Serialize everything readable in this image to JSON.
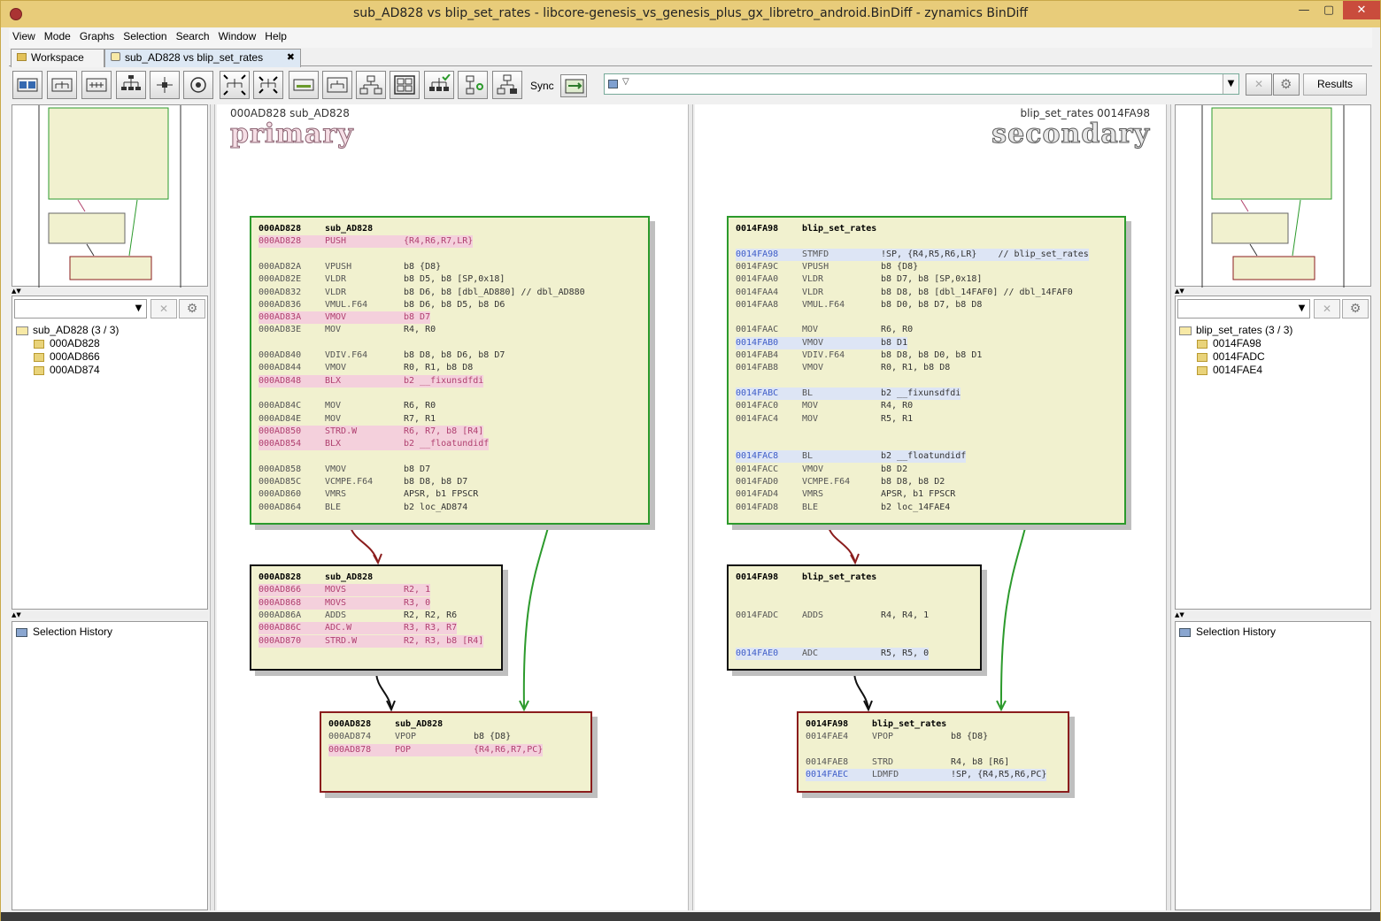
{
  "window": {
    "title": "sub_AD828 vs blip_set_rates - libcore-genesis_vs_genesis_plus_gx_libretro_android.BinDiff - zynamics BinDiff",
    "minimize": "—",
    "maximize": "▢",
    "close": "✕"
  },
  "menubar": {
    "items": [
      {
        "label": "View"
      },
      {
        "label": "Mode"
      },
      {
        "label": "Graphs"
      },
      {
        "label": "Selection"
      },
      {
        "label": "Search"
      },
      {
        "label": "Window"
      },
      {
        "label": "Help"
      }
    ]
  },
  "tabs": {
    "workspace": "Workspace",
    "active": "sub_AD828 vs blip_set_rates",
    "close_glyph": "✖"
  },
  "toolbar": {
    "sync_label": "Sync",
    "results_label": "Results",
    "search_value": "",
    "clear_glyph": "✕",
    "gear_glyph": "⚙",
    "dropdown_glyph": "▼"
  },
  "left": {
    "tree_root": "sub_AD828 (3 / 3)",
    "tree_items": [
      "000AD828",
      "000AD866",
      "000AD874"
    ],
    "history_label": "Selection History"
  },
  "right": {
    "tree_root": "blip_set_rates (3 / 3)",
    "tree_items": [
      "0014FA98",
      "0014FADC",
      "0014FAE4"
    ],
    "history_label": "Selection History"
  },
  "primary": {
    "header": "000AD828  sub_AD828",
    "word": "primary",
    "blocks": [
      {
        "lines": [
          {
            "t": "h",
            "a": "000AD828",
            "m": "sub_AD828"
          },
          {
            "t": "p",
            "a": "000AD828",
            "m": "PUSH",
            "o": "{R4,R6,R7,LR}"
          },
          {
            "t": "e"
          },
          {
            "t": "n",
            "a": "000AD82A",
            "m": "VPUSH",
            "o": "b8 {D8}"
          },
          {
            "t": "n",
            "a": "000AD82E",
            "m": "VLDR",
            "o": "b8 D5, b8 [SP,0x18]"
          },
          {
            "t": "n",
            "a": "000AD832",
            "m": "VLDR",
            "o": "b8 D6, b8 [dbl_AD880] // dbl_AD880"
          },
          {
            "t": "n",
            "a": "000AD836",
            "m": "VMUL.F64",
            "o": "b8 D6, b8 D5, b8 D6"
          },
          {
            "t": "p",
            "a": "000AD83A",
            "m": "VMOV",
            "o": "b8 D7"
          },
          {
            "t": "n",
            "a": "000AD83E",
            "m": "MOV",
            "o": "R4, R0"
          },
          {
            "t": "e"
          },
          {
            "t": "n",
            "a": "000AD840",
            "m": "VDIV.F64",
            "o": "b8 D8, b8 D6, b8 D7"
          },
          {
            "t": "n",
            "a": "000AD844",
            "m": "VMOV",
            "o": "R0, R1, b8 D8"
          },
          {
            "t": "p",
            "a": "000AD848",
            "m": "BLX",
            "o": "b2 __fixunsdfdi"
          },
          {
            "t": "e"
          },
          {
            "t": "n",
            "a": "000AD84C",
            "m": "MOV",
            "o": "R6, R0"
          },
          {
            "t": "n",
            "a": "000AD84E",
            "m": "MOV",
            "o": "R7, R1"
          },
          {
            "t": "p",
            "a": "000AD850",
            "m": "STRD.W",
            "o": "R6, R7, b8 [R4]"
          },
          {
            "t": "p",
            "a": "000AD854",
            "m": "BLX",
            "o": "b2 __floatundidf"
          },
          {
            "t": "e"
          },
          {
            "t": "n",
            "a": "000AD858",
            "m": "VMOV",
            "o": "b8 D7"
          },
          {
            "t": "n",
            "a": "000AD85C",
            "m": "VCMPE.F64",
            "o": "b8 D8, b8 D7"
          },
          {
            "t": "n",
            "a": "000AD860",
            "m": "VMRS",
            "o": "APSR, b1 FPSCR"
          },
          {
            "t": "n",
            "a": "000AD864",
            "m": "BLE",
            "o": "b2 loc_AD874"
          }
        ]
      },
      {
        "lines": [
          {
            "t": "h",
            "a": "000AD828",
            "m": "sub_AD828"
          },
          {
            "t": "p",
            "a": "000AD866",
            "m": "MOVS",
            "o": "R2, 1"
          },
          {
            "t": "p",
            "a": "000AD868",
            "m": "MOVS",
            "o": "R3, 0"
          },
          {
            "t": "n",
            "a": "000AD86A",
            "m": "ADDS",
            "o": "R2, R2, R6"
          },
          {
            "t": "p",
            "a": "000AD86C",
            "m": "ADC.W",
            "o": "R3, R3, R7"
          },
          {
            "t": "p",
            "a": "000AD870",
            "m": "STRD.W",
            "o": "R2, R3, b8 [R4]"
          }
        ]
      },
      {
        "lines": [
          {
            "t": "h",
            "a": "000AD828",
            "m": "sub_AD828"
          },
          {
            "t": "n",
            "a": "000AD874",
            "m": "VPOP",
            "o": "b8 {D8}"
          },
          {
            "t": "p",
            "a": "000AD878",
            "m": "POP",
            "o": "{R4,R6,R7,PC}"
          }
        ]
      }
    ]
  },
  "secondary": {
    "header": "blip_set_rates  0014FA98",
    "word": "secondary",
    "blocks": [
      {
        "lines": [
          {
            "t": "h",
            "a": "0014FA98",
            "m": "blip_set_rates"
          },
          {
            "t": "e"
          },
          {
            "t": "b",
            "a": "0014FA98",
            "m": "STMFD",
            "o": "!SP, {R4,R5,R6,LR}    // blip_set_rates"
          },
          {
            "t": "n",
            "a": "0014FA9C",
            "m": "VPUSH",
            "o": "b8 {D8}"
          },
          {
            "t": "n",
            "a": "0014FAA0",
            "m": "VLDR",
            "o": "b8 D7, b8 [SP,0x18]"
          },
          {
            "t": "n",
            "a": "0014FAA4",
            "m": "VLDR",
            "o": "b8 D8, b8 [dbl_14FAF0] // dbl_14FAF0"
          },
          {
            "t": "n",
            "a": "0014FAA8",
            "m": "VMUL.F64",
            "o": "b8 D0, b8 D7, b8 D8"
          },
          {
            "t": "e"
          },
          {
            "t": "n",
            "a": "0014FAAC",
            "m": "MOV",
            "o": "R6, R0"
          },
          {
            "t": "b",
            "a": "0014FAB0",
            "m": "VMOV",
            "o": "b8 D1"
          },
          {
            "t": "n",
            "a": "0014FAB4",
            "m": "VDIV.F64",
            "o": "b8 D8, b8 D0, b8 D1"
          },
          {
            "t": "n",
            "a": "0014FAB8",
            "m": "VMOV",
            "o": "R0, R1, b8 D8"
          },
          {
            "t": "e"
          },
          {
            "t": "b",
            "a": "0014FABC",
            "m": "BL",
            "o": "b2 __fixunsdfdi"
          },
          {
            "t": "n",
            "a": "0014FAC0",
            "m": "MOV",
            "o": "R4, R0"
          },
          {
            "t": "n",
            "a": "0014FAC4",
            "m": "MOV",
            "o": "R5, R1"
          },
          {
            "t": "e"
          },
          {
            "t": "e"
          },
          {
            "t": "b",
            "a": "0014FAC8",
            "m": "BL",
            "o": "b2 __floatundidf"
          },
          {
            "t": "n",
            "a": "0014FACC",
            "m": "VMOV",
            "o": "b8 D2"
          },
          {
            "t": "n",
            "a": "0014FAD0",
            "m": "VCMPE.F64",
            "o": "b8 D8, b8 D2"
          },
          {
            "t": "n",
            "a": "0014FAD4",
            "m": "VMRS",
            "o": "APSR, b1 FPSCR"
          },
          {
            "t": "n",
            "a": "0014FAD8",
            "m": "BLE",
            "o": "b2 loc_14FAE4"
          }
        ]
      },
      {
        "lines": [
          {
            "t": "h",
            "a": "0014FA98",
            "m": "blip_set_rates"
          },
          {
            "t": "e"
          },
          {
            "t": "e"
          },
          {
            "t": "n",
            "a": "0014FADC",
            "m": "ADDS",
            "o": "R4, R4, 1"
          },
          {
            "t": "e"
          },
          {
            "t": "e"
          },
          {
            "t": "b",
            "a": "0014FAE0",
            "m": "ADC",
            "o": "R5, R5, 0"
          }
        ]
      },
      {
        "lines": [
          {
            "t": "h",
            "a": "0014FA98",
            "m": "blip_set_rates"
          },
          {
            "t": "n",
            "a": "0014FAE4",
            "m": "VPOP",
            "o": "b8 {D8}"
          },
          {
            "t": "e"
          },
          {
            "t": "n",
            "a": "0014FAE8",
            "m": "STRD",
            "o": "R4, b8 [R6]"
          },
          {
            "t": "b",
            "a": "0014FAEC",
            "m": "LDMFD",
            "o": "!SP, {R4,R5,R6,PC}"
          }
        ]
      }
    ]
  },
  "colors": {
    "match_green": "#2c9a2c",
    "unmatched_red": "#8b1d1d",
    "changed_pink": "#f4d0dc",
    "block_fill": "#f1f1cf"
  }
}
